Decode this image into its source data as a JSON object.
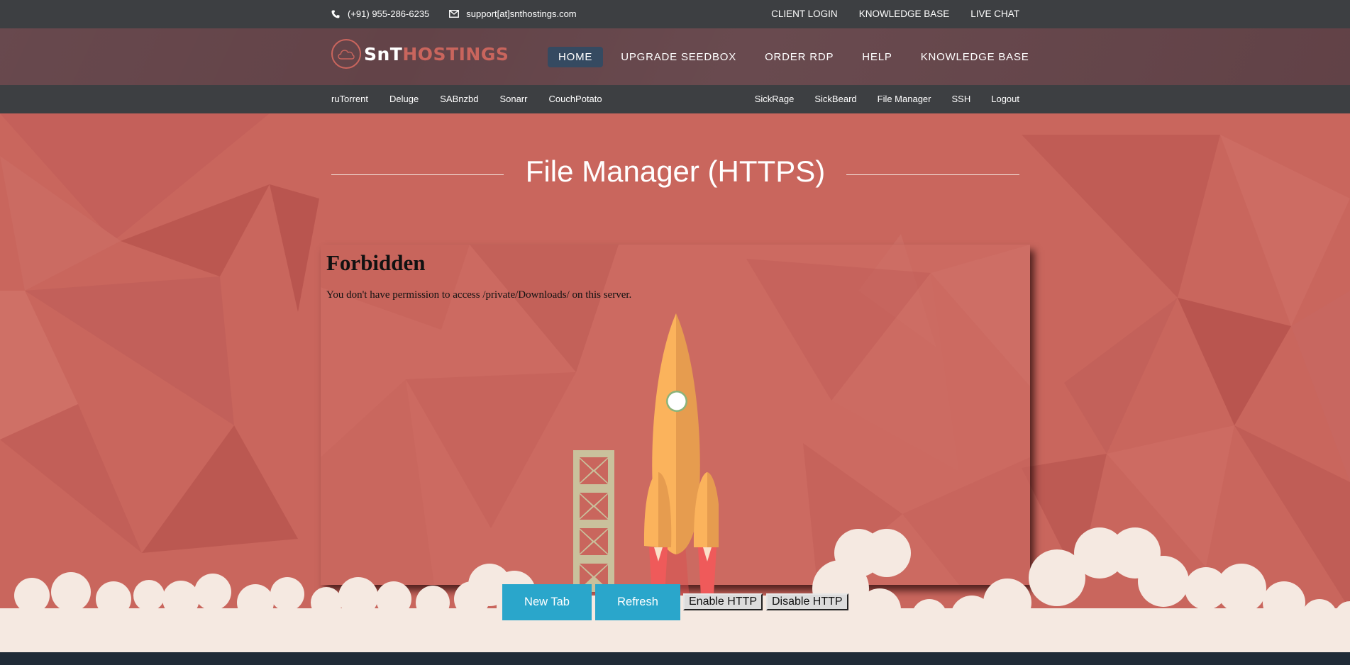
{
  "topbar": {
    "phone_icon": "phone-icon",
    "phone": "(+91) 955-286-6235",
    "email_icon": "envelope-icon",
    "email": "support[at]snthostings.com",
    "links": [
      "CLIENT LOGIN",
      "KNOWLEDGE BASE",
      "LIVE CHAT"
    ]
  },
  "header": {
    "logo_icon": "cloud-icon",
    "logo_part1": "SnT",
    "logo_part2": "HOSTINGS",
    "nav": [
      {
        "label": "HOME",
        "active": true
      },
      {
        "label": "UPGRADE SEEDBOX",
        "active": false
      },
      {
        "label": "ORDER RDP",
        "active": false
      },
      {
        "label": "HELP",
        "active": false
      },
      {
        "label": "KNOWLEDGE BASE",
        "active": false
      }
    ]
  },
  "subnav": {
    "left": [
      "ruTorrent",
      "Deluge",
      "SABnzbd",
      "Sonarr",
      "CouchPotato"
    ],
    "right": [
      "SickRage",
      "SickBeard",
      "File Manager",
      "SSH",
      "Logout"
    ]
  },
  "main": {
    "title": "File Manager (HTTPS)",
    "frame": {
      "heading": "Forbidden",
      "message": "You don't have permission to access /private/Downloads/ on this server."
    },
    "buttons": {
      "new_tab": "New Tab",
      "refresh": "Refresh",
      "enable_http": "Enable HTTP",
      "disable_http": "Disable HTTP"
    }
  },
  "colors": {
    "topbar_bg": "#3d3f42",
    "header_bg": "#634348",
    "accent": "#c9655d",
    "active_nav": "#354a61",
    "hero_bg": "#c9665d",
    "button_blue": "#2aa6cb",
    "cloud": "#f5e9e1",
    "footer_bg": "#202b37",
    "rocket": "#fbb35c"
  }
}
